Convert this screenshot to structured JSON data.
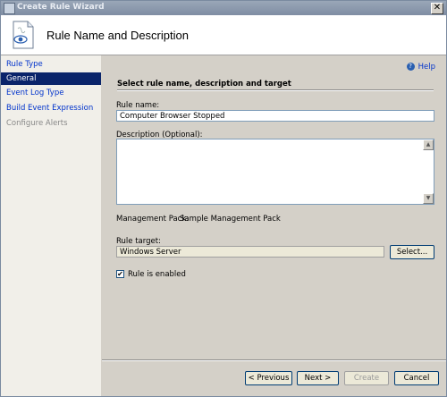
{
  "window": {
    "title": "Create Rule Wizard",
    "close_label": "✕"
  },
  "header": {
    "title": "Rule Name and Description"
  },
  "nav": {
    "items": [
      {
        "label": "Rule Type",
        "state": "link"
      },
      {
        "label": "General",
        "state": "selected"
      },
      {
        "label": "Event Log Type",
        "state": "link"
      },
      {
        "label": "Build Event Expression",
        "state": "link"
      },
      {
        "label": "Configure Alerts",
        "state": "disabled"
      }
    ]
  },
  "help": {
    "label": "Help",
    "icon": "help-icon",
    "icon_glyph": "?"
  },
  "form": {
    "section_title": "Select rule name, description and target",
    "rule_name_label": "Rule name:",
    "rule_name_value": "Computer Browser Stopped",
    "description_label": "Description (Optional):",
    "description_value": "",
    "management_pack_label": "Management Pack:",
    "management_pack_value": "Sample Management Pack",
    "rule_target_label": "Rule target:",
    "rule_target_value": "Windows Server",
    "select_button_label": "Select...",
    "rule_enabled_label": "Rule is enabled",
    "rule_enabled_checked": true,
    "check_glyph": "✔",
    "scroll_up_glyph": "▲",
    "scroll_down_glyph": "▼"
  },
  "footer": {
    "previous_label": "< Previous",
    "next_label": "Next >",
    "create_label": "Create",
    "cancel_label": "Cancel"
  },
  "colors": {
    "nav_selected_bg": "#0a246a",
    "link": "#0033cc"
  }
}
